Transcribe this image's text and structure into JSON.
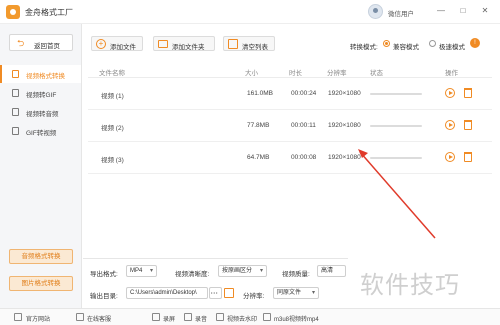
{
  "app": {
    "title": "金舟格式工厂"
  },
  "user": {
    "name": "微信用户"
  },
  "window_controls": [
    "—",
    "□",
    "✕"
  ],
  "sidebar": {
    "back_label": "返回首页",
    "items": [
      {
        "label": "视频格式转换",
        "active": true
      },
      {
        "label": "视频转GIF",
        "active": false
      },
      {
        "label": "视频转音频",
        "active": false
      },
      {
        "label": "GIF转视频",
        "active": false
      }
    ],
    "promo_buttons": [
      "音频格式转换",
      "图片格式转换"
    ]
  },
  "toolbar": {
    "add_file_label": "添加文件",
    "add_folder_label": "添加文件夹",
    "clear_list_label": "清空列表",
    "mode_label": "转换模式:",
    "mode_options": [
      "兼容模式",
      "极速模式"
    ],
    "mode_selected": "兼容模式",
    "help_badge": "!"
  },
  "table": {
    "columns": [
      "文件名称",
      "大小",
      "时长",
      "分辨率",
      "状态",
      "操作"
    ],
    "rows": [
      {
        "name": "视频 (1)",
        "size": "161.0MB",
        "duration": "00:00:24",
        "resolution": "1920×1080",
        "progress": 0
      },
      {
        "name": "视频 (2)",
        "size": "77.8MB",
        "duration": "00:00:11",
        "resolution": "1920×1080",
        "progress": 0
      },
      {
        "name": "视频 (3)",
        "size": "64.7MB",
        "duration": "00:00:08",
        "resolution": "1920×1080",
        "progress": 0
      }
    ]
  },
  "settings": {
    "output_format_label": "导出格式:",
    "output_format_value": "MP4",
    "clarity_label": "视频清晰度:",
    "clarity_value": "按原画区分",
    "quality_label": "视频质量:",
    "quality_value": "高清",
    "output_dir_label": "输出目录:",
    "output_dir_value": "C:\\Users\\admin\\Desktop\\",
    "output_dir_more": "• • •",
    "resolution_label": "分辨率:",
    "resolution_value": "同原文件"
  },
  "footer": {
    "items": [
      "官方网站",
      "在线客服",
      "录屏",
      "录音",
      "视频去水印",
      "m3u8视频转mp4"
    ]
  },
  "watermark": "软件技巧",
  "colors": {
    "accent": "#f08b24",
    "annotation_arrow": "#e03b2b"
  }
}
